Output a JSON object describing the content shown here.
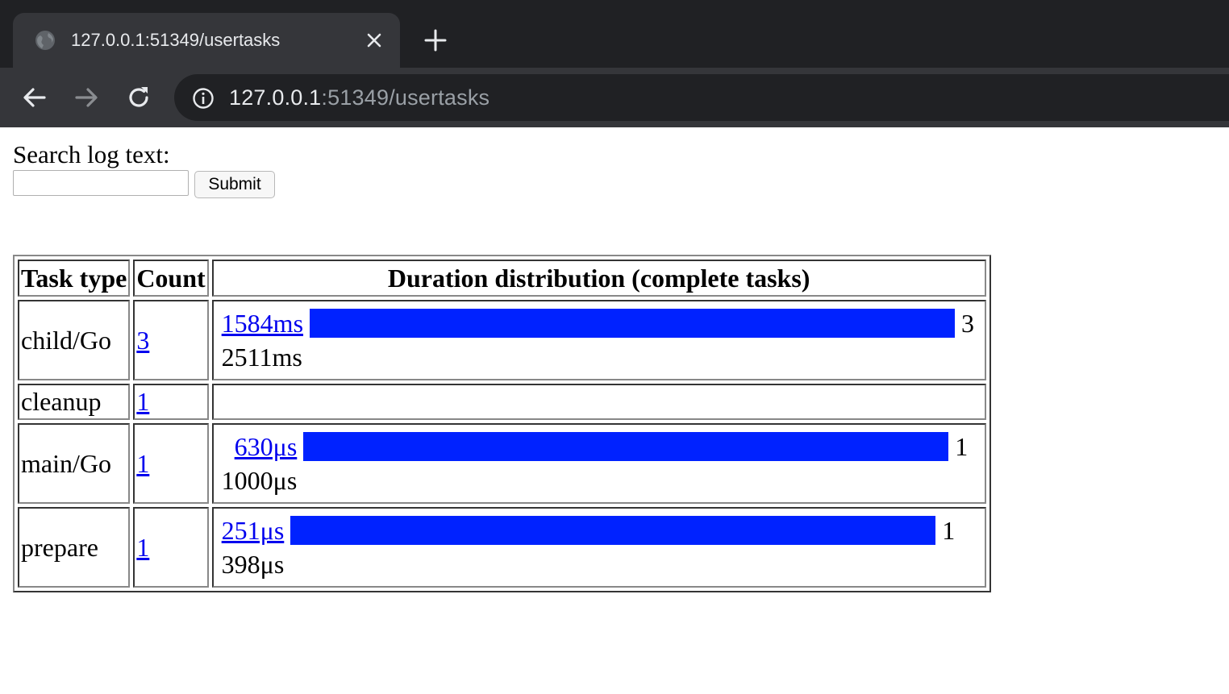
{
  "browser": {
    "tab_title": "127.0.0.1:51349/usertasks",
    "url_host": "127.0.0.1",
    "url_rest": ":51349/usertasks"
  },
  "search": {
    "label": "Search log text:",
    "input_value": "",
    "submit_label": "Submit"
  },
  "table": {
    "headers": [
      "Task type",
      "Count",
      "Duration distribution (complete tasks)"
    ],
    "rows": [
      {
        "task_type": "child/Go",
        "count": "3",
        "bucket_start": "1584ms",
        "bucket_count": "3",
        "bucket_end": "2511ms",
        "bar_fraction": 1.0
      },
      {
        "task_type": "cleanup",
        "count": "1",
        "bucket_start": "",
        "bucket_count": "",
        "bucket_end": "",
        "bar_fraction": 0
      },
      {
        "task_type": "main/Go",
        "count": "1",
        "bucket_start": "630μs",
        "bucket_count": "1",
        "bucket_end": "1000μs",
        "bar_fraction": 1.0
      },
      {
        "task_type": "prepare",
        "count": "1",
        "bucket_start": "251μs",
        "bucket_count": "1",
        "bucket_end": "398μs",
        "bar_fraction": 1.0
      }
    ]
  },
  "colors": {
    "bar": "#0022ff",
    "link": "#0000ee"
  }
}
